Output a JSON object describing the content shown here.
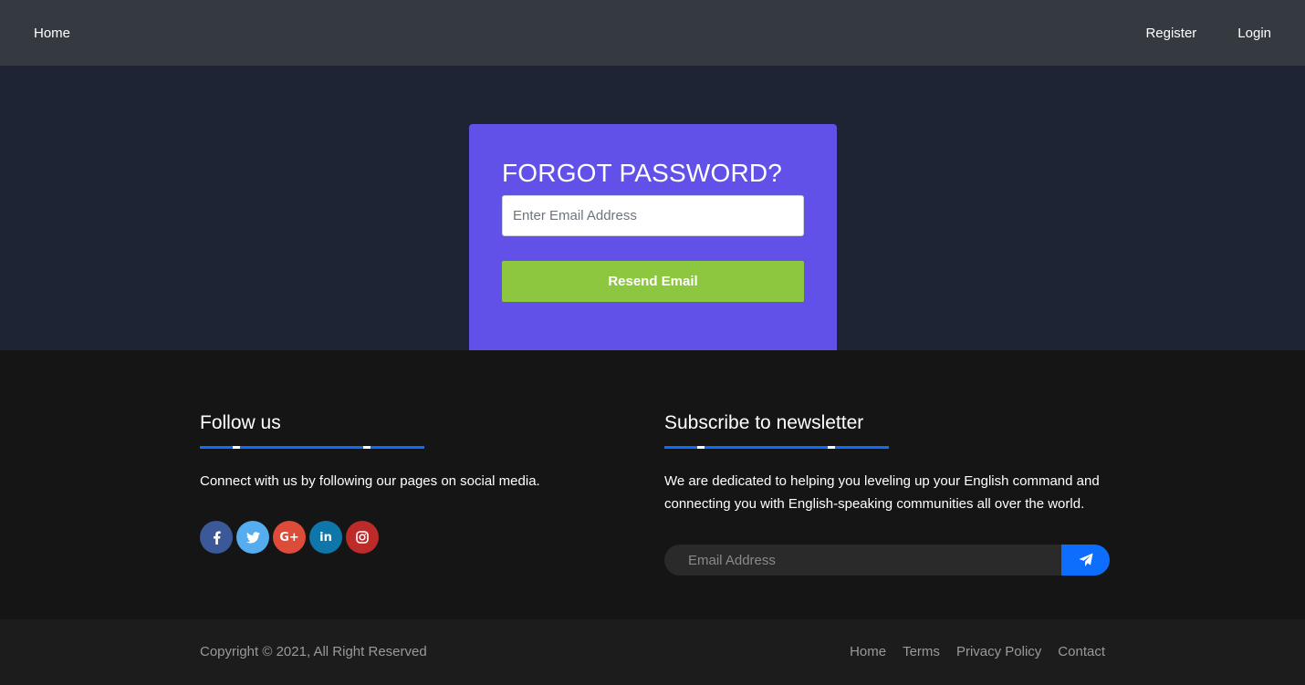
{
  "nav": {
    "home": "Home",
    "register": "Register",
    "login": "Login"
  },
  "forgot": {
    "title": "FORGOT PASSWORD?",
    "email_placeholder": "Enter Email Address",
    "email_value": "",
    "button_label": "Resend Email",
    "card_color": "#6251e8",
    "button_color": "#8dc63f"
  },
  "footer": {
    "follow": {
      "title": "Follow us",
      "text": "Connect with us by following our pages on social media.",
      "social": [
        {
          "name": "facebook-icon",
          "glyph": "f",
          "color": "#3b5998"
        },
        {
          "name": "twitter-icon",
          "glyph": "🐦",
          "color": "#55acee"
        },
        {
          "name": "google-plus-icon",
          "glyph": "G+",
          "color": "#dd4b39"
        },
        {
          "name": "linkedin-icon",
          "glyph": "in",
          "color": "#0e76a8"
        },
        {
          "name": "instagram-icon",
          "glyph": "◎",
          "color": "#bc2a2a"
        }
      ]
    },
    "newsletter": {
      "title": "Subscribe to newsletter",
      "text": "We are dedicated to helping you leveling up your English command and connecting you with English-speaking communities all over the world.",
      "email_placeholder": "Email Address",
      "send_icon": "paper-plane-icon"
    },
    "accent_color": "#0d6efd"
  },
  "bottom": {
    "copyright": "Copyright © 2021, All Right Reserved",
    "links": [
      "Home",
      "Terms",
      "Privacy Policy",
      "Contact"
    ]
  }
}
